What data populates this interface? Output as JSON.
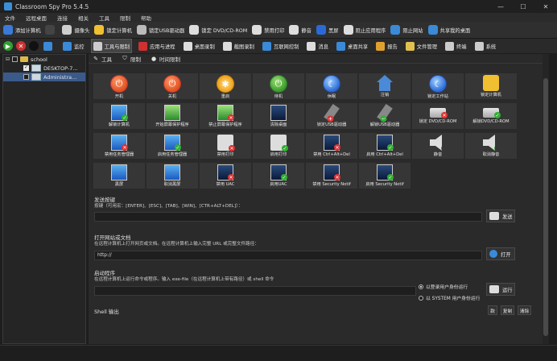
{
  "window": {
    "title": "Classroom Spy Pro 5.4.5",
    "min": "—",
    "max": "☐",
    "close": "✕"
  },
  "menu": [
    "文件",
    "远程桌面",
    "连接",
    "相关",
    "工具",
    "限制",
    "帮助"
  ],
  "toolbar1": [
    {
      "label": "添加计算机",
      "icon": "add-computer-icon",
      "color": "#3a7ad8"
    },
    {
      "label": "",
      "icon": "dropdown-icon",
      "color": "#444"
    },
    {
      "label": "摄像头",
      "icon": "webcam-icon",
      "color": "#cfcfcf"
    },
    {
      "label": "锁定计算机",
      "icon": "lock-icon",
      "color": "#f0c030"
    },
    {
      "label": "锁定USB驱动器",
      "icon": "usb-icon",
      "color": "#bbbbbb"
    },
    {
      "label": "锁定 DVD/CD-ROM",
      "icon": "disc-icon",
      "color": "#dddddd"
    },
    {
      "label": "禁用打印",
      "icon": "printer-icon",
      "color": "#dddddd"
    },
    {
      "label": "静音",
      "icon": "mute-icon",
      "color": "#dddddd"
    },
    {
      "label": "黑屏",
      "icon": "blackscreen-icon",
      "color": "#2a6ad8"
    },
    {
      "label": "阻止应用程序",
      "icon": "block-app-icon",
      "color": "#dddddd"
    },
    {
      "label": "阻止网站",
      "icon": "block-web-icon",
      "color": "#3a8ad8"
    },
    {
      "label": "共享我的桌面",
      "icon": "share-desktop-icon",
      "color": "#3a8ad8"
    }
  ],
  "toolbar2": {
    "round_icons": [
      {
        "name": "green-go-icon",
        "glyph": "▶",
        "color": "#30a030"
      },
      {
        "name": "red-stop-icon",
        "glyph": "✕",
        "color": "#d03030"
      },
      {
        "name": "black-square-icon",
        "glyph": "",
        "color": "#111111"
      }
    ],
    "items": [
      {
        "label": "",
        "icon": "grid-icon",
        "color": "#3a8ad8",
        "active": false
      },
      {
        "label": "监控",
        "icon": "monitor-icon",
        "color": "#3a8ad8",
        "active": false
      },
      {
        "label": "工具与限制",
        "icon": "tools-icon",
        "color": "#cccccc",
        "active": true
      },
      {
        "label": "应用与进程",
        "icon": "apps-icon",
        "color": "#d03030",
        "active": false
      },
      {
        "label": "桌面录制",
        "icon": "record-icon",
        "color": "#dddddd",
        "active": false
      },
      {
        "label": "截图录制",
        "icon": "screenshot-icon",
        "color": "#dddddd",
        "active": false
      },
      {
        "label": "互联网控制",
        "icon": "internet-icon",
        "color": "#3a8ad8",
        "active": false
      },
      {
        "label": "消息",
        "icon": "message-icon",
        "color": "#dddddd",
        "active": false
      },
      {
        "label": "桌面共享",
        "icon": "desktop-share-icon",
        "color": "#3a8ad8",
        "active": false
      },
      {
        "label": "报告",
        "icon": "report-icon",
        "color": "#e0a030",
        "active": false
      },
      {
        "label": "文件管理",
        "icon": "file-manager-icon",
        "color": "#e0c050",
        "active": false
      },
      {
        "label": "终端",
        "icon": "terminal-icon",
        "color": "#cccccc",
        "active": false
      },
      {
        "label": "系统",
        "icon": "system-icon",
        "color": "#cccccc",
        "active": false
      }
    ]
  },
  "tree": [
    {
      "label": "school",
      "level": 0,
      "checked": false,
      "kind": "folder",
      "expand": "⊟"
    },
    {
      "label": "DESKTOP-7...",
      "level": 1,
      "checked": true,
      "kind": "pc",
      "expand": ""
    },
    {
      "label": "Administra...",
      "level": 1,
      "checked": false,
      "kind": "pc",
      "expand": "",
      "selected": true
    }
  ],
  "subtabs": [
    {
      "label": "工具",
      "icon": "wrench-icon",
      "glyph": "✎"
    },
    {
      "label": "限制",
      "icon": "shield-icon",
      "glyph": "⛉"
    },
    {
      "label": "时间限制",
      "icon": "clock-icon",
      "glyph": "●"
    }
  ],
  "commands": [
    [
      {
        "label": "开机",
        "icon": "power-on-icon",
        "type": "power"
      },
      {
        "label": "关机",
        "icon": "power-off-icon",
        "type": "power"
      },
      {
        "label": "重启",
        "icon": "restart-icon",
        "type": "yellow"
      },
      {
        "label": "待机",
        "icon": "standby-icon",
        "type": "green"
      },
      {
        "label": "休眠",
        "icon": "hibernate-icon",
        "type": "blue"
      },
      {
        "label": "注销",
        "icon": "logoff-icon",
        "type": "house"
      },
      {
        "label": "锁定工作站",
        "icon": "lock-workstation-icon",
        "type": "blue"
      },
      {
        "label": "锁定计算机",
        "icon": "lock-computer-icon",
        "type": "lock"
      }
    ],
    [
      {
        "label": "解锁计算机",
        "icon": "unlock-computer-icon",
        "type": "monitor",
        "badge": "green"
      },
      {
        "label": "开始屏幕保护程序",
        "icon": "start-screensaver-icon",
        "type": "monitor-green"
      },
      {
        "label": "禁止屏幕保护程序",
        "icon": "disable-screensaver-icon",
        "type": "monitor-green",
        "badge": "red"
      },
      {
        "label": "清除桌面",
        "icon": "clear-desktop-icon",
        "type": "monitor-dark"
      },
      {
        "label": "锁定USB驱动器",
        "icon": "lock-usb-icon",
        "type": "usb",
        "badge": "red"
      },
      {
        "label": "解锁USB驱动器",
        "icon": "unlock-usb-icon",
        "type": "usb",
        "badge": "green"
      },
      {
        "label": "锁定 DVD/CD-ROM",
        "icon": "lock-dvd-icon",
        "type": "drive",
        "badge": "red"
      },
      {
        "label": "解锁DVD/CD-ROM",
        "icon": "unlock-dvd-icon",
        "type": "drive",
        "badge": "green"
      }
    ],
    [
      {
        "label": "禁用任务管理器",
        "icon": "disable-taskmgr-icon",
        "type": "monitor",
        "badge": "red"
      },
      {
        "label": "启用任务管理器",
        "icon": "enable-taskmgr-icon",
        "type": "monitor",
        "badge": "green"
      },
      {
        "label": "禁用打印",
        "icon": "disable-print-icon",
        "type": "printer",
        "badge": "red"
      },
      {
        "label": "启用打印",
        "icon": "enable-print-icon",
        "type": "printer",
        "badge": "green"
      },
      {
        "label": "禁用 Ctrl+Alt+Del",
        "icon": "disable-cad-icon",
        "type": "monitor-dark",
        "badge": "red"
      },
      {
        "label": "启用 Ctrl+Alt+Del",
        "icon": "enable-cad-icon",
        "type": "monitor-dark",
        "badge": "green"
      },
      {
        "label": "静音",
        "icon": "mute-icon",
        "type": "speaker",
        "badge": "red"
      },
      {
        "label": "取消静音",
        "icon": "unmute-icon",
        "type": "speaker",
        "badge": "green"
      }
    ],
    [
      {
        "label": "黑屏",
        "icon": "black-screen-icon",
        "type": "monitor"
      },
      {
        "label": "取消黑屏",
        "icon": "cancel-black-screen-icon",
        "type": "monitor"
      },
      {
        "label": "禁用 UAC",
        "icon": "disable-uac-icon",
        "type": "monitor-dark",
        "badge": "red"
      },
      {
        "label": "启用UAC",
        "icon": "enable-uac-icon",
        "type": "monitor-dark",
        "badge": "green"
      },
      {
        "label": "禁用 Security Notif",
        "icon": "disable-security-notif-icon",
        "type": "monitor-dark",
        "badge": "red"
      },
      {
        "label": "启用 Security Notif",
        "icon": "enable-security-notif-icon",
        "type": "monitor-dark",
        "badge": "green"
      }
    ]
  ],
  "send_keys": {
    "title": "发送按键",
    "hint": "按键（可用宏：[ENTER]、[ESC]、[TAB]、[WIN]、[CTR+ALT+DEL]）：",
    "value": "",
    "button": "发送"
  },
  "open_url": {
    "title": "打开网站或文档",
    "hint": "在远程计算机上打开网页或文档。在远程计算机上输入完整 URL 或完整文件路径：",
    "value": "http://",
    "button": "打开"
  },
  "run_program": {
    "title": "启动程序",
    "hint": "在远程计算机上运行命令或程序。输入 exe-file（在远程计算机上带有路径）或 shell 命令",
    "value": "",
    "radio1": "以登录用户身份运行",
    "radio2": "以 SYSTEM 用户身份运行",
    "button": "运行"
  },
  "shell": {
    "label": "Shell 输出",
    "btn1": "款",
    "btn2": "复制",
    "btn3": "清除"
  }
}
